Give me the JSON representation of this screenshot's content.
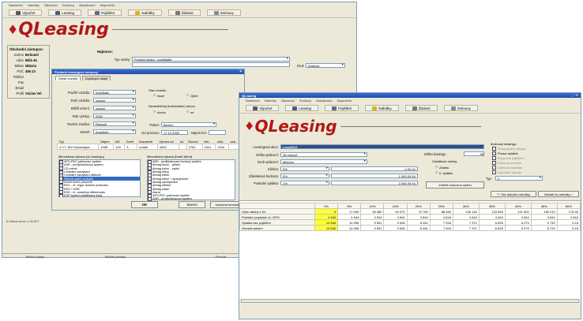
{
  "back_window": {
    "menu": [
      "Nastavení",
      "Nabídky",
      "Zákazníci",
      "Smlouvy",
      "Aktualizace",
      "Nápověda"
    ],
    "toolbar": [
      {
        "label": "Výpočet",
        "icon": "car-icon",
        "color": "#556"
      },
      {
        "label": "Leasing",
        "icon": "leasing-icon",
        "color": "#557"
      },
      {
        "label": "Pojištění",
        "icon": "insurance-icon",
        "color": "#668"
      },
      {
        "label": "Nabídky",
        "icon": "offers-icon",
        "color": "#d8b020"
      },
      {
        "label": "Žádosti",
        "icon": "requests-icon",
        "color": "#777"
      },
      {
        "label": "Smlouvy",
        "icon": "contracts-icon",
        "color": "#889"
      }
    ],
    "logo": "QLeasing",
    "sales_rep": {
      "heading": "Obchodní zástupce:",
      "fields": [
        {
          "label": "Jméno",
          "value": "Bohumil"
        },
        {
          "label": "Ulice",
          "value": "Bělá 45"
        },
        {
          "label": "Město",
          "value": "Mlázno"
        },
        {
          "label": "PSČ",
          "value": "456 23"
        },
        {
          "label": "Telefon",
          "value": ""
        },
        {
          "label": "Fax",
          "value": ""
        },
        {
          "label": "Email",
          "value": ""
        },
        {
          "label": "Profil",
          "value": "Václav Vel"
        }
      ]
    },
    "applicant": {
      "heading": "Nájemce:",
      "subject_label": "Typ osoby:",
      "subject_value": "Fyzická osoba - podnikatel",
      "right_label": "Druh",
      "right_value": "Analýza"
    },
    "version": "E-Klient verze 1.00.027",
    "status_left": "Běžící příjmy",
    "status_mid": "Běžné položky",
    "status_right": "Provize"
  },
  "dialog": {
    "title": "Předmět leasingové smlouvy",
    "close": "✕",
    "tabs": [
      "Detail vozidla",
      "Doplňující údaje"
    ],
    "fields": [
      {
        "label": "Použití vozidla:",
        "value": "podnikání"
      },
      {
        "label": "Druh vozidla:",
        "value": "osobní"
      },
      {
        "label": "Bližší určení:",
        "value": "osobní"
      },
      {
        "label": "Rok výroby:",
        "value": "2002"
      },
      {
        "label": "Tovární značka:",
        "value": "Renault"
      },
      {
        "label": "Model:",
        "value": "Avantime"
      }
    ],
    "state_heading": "Stav vozidla:",
    "state_options": [
      "Nové",
      "Ojeté"
    ],
    "insure_heading": "Nezatížitelný (individuální) dovoz:",
    "insure_options": [
      "dovoz",
      "ne"
    ],
    "fuel_label": "Palivo:",
    "fuel_value": "Benzín",
    "date_label": "Do provozu:",
    "date_value": "17.12.2002",
    "price_label": "Najeto km:",
    "type_header": [
      "Typ",
      "Objem",
      "kW",
      "Dveří",
      "Karoserie",
      "Výroba od",
      "do",
      "Rozvor",
      "Hm.",
      "celk.",
      "ceb."
    ],
    "type_row": [
      "2.0 T 16V Dynamique",
      "1998",
      "120",
      "3",
      "kombi",
      "2002",
      "",
      "2762",
      "1641",
      "2220",
      ""
    ],
    "eq_heading": "Mimořádná výbava (do leasingu)",
    "eq_items": [
      {
        "text": "APS-PDC parkovací systém",
        "checked": true,
        "selected": false
      },
      {
        "text": "ASR - protiprokluzový systém",
        "checked": true,
        "selected": false
      },
      {
        "text": "CD měnič",
        "checked": true,
        "selected": false
      },
      {
        "text": "Centrální zamykání",
        "checked": true,
        "selected": false
      },
      {
        "text": "Centrální zamykání dálkové",
        "checked": true,
        "selected": false
      },
      {
        "text": "Dělená zadní sedadla",
        "checked": true,
        "selected": true
      },
      {
        "text": "Dveře boční posuvné",
        "checked": false,
        "selected": false
      },
      {
        "text": "EDC - el. regul. tlumiče podvozku",
        "checked": false,
        "selected": false
      },
      {
        "text": "EDS + ASR",
        "checked": false,
        "selected": false
      },
      {
        "text": "EDS - el. uzávěrka diferenciálu",
        "checked": false,
        "selected": false
      },
      {
        "text": "ESP systém stabilizace jízdy",
        "checked": false,
        "selected": false
      }
    ],
    "std_heading": "Mimořádná výbava (hradí klient)",
    "std_items": [
      {
        "text": "ABS - protiblokovací brzdový systém",
        "checked": false
      },
      {
        "text": "Airbag boční - přední",
        "checked": false
      },
      {
        "text": "Airbag boční - zadní",
        "checked": false
      },
      {
        "text": "Airbag hlavy",
        "checked": false
      },
      {
        "text": "Airbag řidiče",
        "checked": false
      },
      {
        "text": "Airbag řidiče + spolujezdce",
        "checked": false
      },
      {
        "text": "Airbag spolujezdce",
        "checked": false
      },
      {
        "text": "Airbag střešní",
        "checked": false
      },
      {
        "text": "Airbag zadní",
        "checked": false
      },
      {
        "text": "Alarm",
        "checked": false
      },
      {
        "text": "APS-PDC parkovací systém",
        "checked": false
      },
      {
        "text": "ASR - protiprokluzový systém",
        "checked": false
      }
    ],
    "ok": "OK",
    "cancel": "Storno",
    "clear": "Vymazat formulář"
  },
  "front_window": {
    "title": "QLeasing",
    "win_controls": "_ ▫ ✕",
    "menu": [
      "Nastavení",
      "Nabídky",
      "Zákazníci",
      "Smlouvy",
      "Aktualizace",
      "Nápověda"
    ],
    "toolbar": [
      {
        "label": "Výpočet",
        "icon": "car-icon",
        "color": "#556"
      },
      {
        "label": "Leasing",
        "icon": "leasing-icon",
        "color": "#557"
      },
      {
        "label": "Pojištění",
        "icon": "insurance-icon",
        "color": "#668"
      },
      {
        "label": "Nabídky",
        "icon": "offers-icon",
        "color": "#d8b020"
      },
      {
        "label": "Žádosti",
        "icon": "requests-icon",
        "color": "#777"
      },
      {
        "label": "Smlouvy",
        "icon": "contracts-icon",
        "color": "#889"
      }
    ],
    "logo": "QLeasing",
    "price_label": "Leasingová akce:",
    "price_value": "Lenu0012",
    "form": [
      {
        "label": "Délka splácení:",
        "value": "36 měsíců"
      },
      {
        "label": "Druh splácení:",
        "value": "Měsíční"
      },
      {
        "label": "Záloha:",
        "value": "0%",
        "amount": "0,00 Kč"
      },
      {
        "label": "Zůstatková hodnota:",
        "value": "0%",
        "amount": "1 000,00 Kč"
      },
      {
        "label": "Poslední splátka:",
        "value": "1%",
        "amount": "2 000,00 Kč"
      }
    ],
    "leasing_len_label": "Délka leasingu",
    "leasing_len_value": "36",
    "start_heading": "Začátkové zálohy:",
    "start_options": [
      "Zálohu",
      "0. splátku"
    ],
    "change_btn": "Změnit úrokovou sazbu",
    "options_heading": "Možnosti leasingu:",
    "options": [
      {
        "text": "Financování výkupu",
        "checked": false
      },
      {
        "text": "Fixace splátek",
        "checked": true
      },
      {
        "text": "Rozpočet pojištění",
        "checked": false
      },
      {
        "text": "Zahrnutí povinné",
        "checked": false
      },
      {
        "text": "Zahrnutí havarijní",
        "checked": false
      },
      {
        "text": "Vykonání výkupu",
        "checked": false
      }
    ],
    "type_label": "Typ:",
    "type_value": "0",
    "print_btn": "Tisk aktuální nabídky",
    "add_btn": "Zařadit do nabídky",
    "table": {
      "header": [
        "",
        "0%",
        "5%",
        "10%",
        "15%",
        "20%",
        "25%",
        "30%",
        "35%",
        "40%",
        "45%",
        "50%"
      ],
      "rows": [
        {
          "label": "Výše zálohy v Kč",
          "first": "0",
          "cells": [
            "17 690",
            "35 380",
            "53 070",
            "70 760",
            "88 450",
            "106 140",
            "123 830",
            "141 520",
            "159 210",
            "176 90"
          ]
        },
        {
          "label": "Paušální poplatek vč. DPH",
          "first": "4 644",
          "cells": [
            "4 644",
            "4 644",
            "4 644",
            "4 644",
            "4 644",
            "4 644",
            "4 644",
            "4 644",
            "4 644",
            "4 644"
          ]
        },
        {
          "label": "Splátka bez pojištění",
          "first": "10 640",
          "cells": [
            "10 096",
            "9 551",
            "9 006",
            "8 461",
            "7 916",
            "7 371",
            "6 825",
            "6 279",
            "5 732",
            "5 18"
          ]
        },
        {
          "label": "Úhradit celkem",
          "first": "10 640",
          "cells": [
            "10 096",
            "9 551",
            "9 006",
            "8 461",
            "7 916",
            "7 371",
            "6 825",
            "6 279",
            "5 732",
            "5 18"
          ]
        }
      ]
    }
  }
}
